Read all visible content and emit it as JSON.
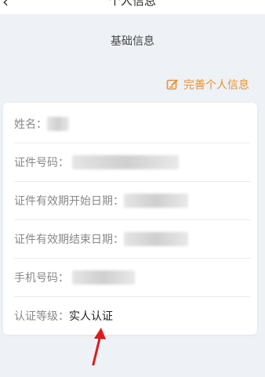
{
  "header": {
    "back_icon": "chevron-left-icon",
    "title": "个人信息"
  },
  "section": {
    "title": "基础信息"
  },
  "edit_link": {
    "icon": "edit-icon",
    "label": "完善个人信息",
    "color": "#e8922f"
  },
  "info_rows": [
    {
      "label": "姓名：",
      "value": ""
    },
    {
      "label": "证件号码：",
      "value": ""
    },
    {
      "label": "证件有效期开始日期：",
      "value": ""
    },
    {
      "label": "证件有效期结束日期：",
      "value": ""
    },
    {
      "label": "手机号码：",
      "value": ""
    },
    {
      "label": "认证等级：",
      "value": "实人认证"
    }
  ],
  "annotation": {
    "arrow_color": "#d81e1e"
  }
}
